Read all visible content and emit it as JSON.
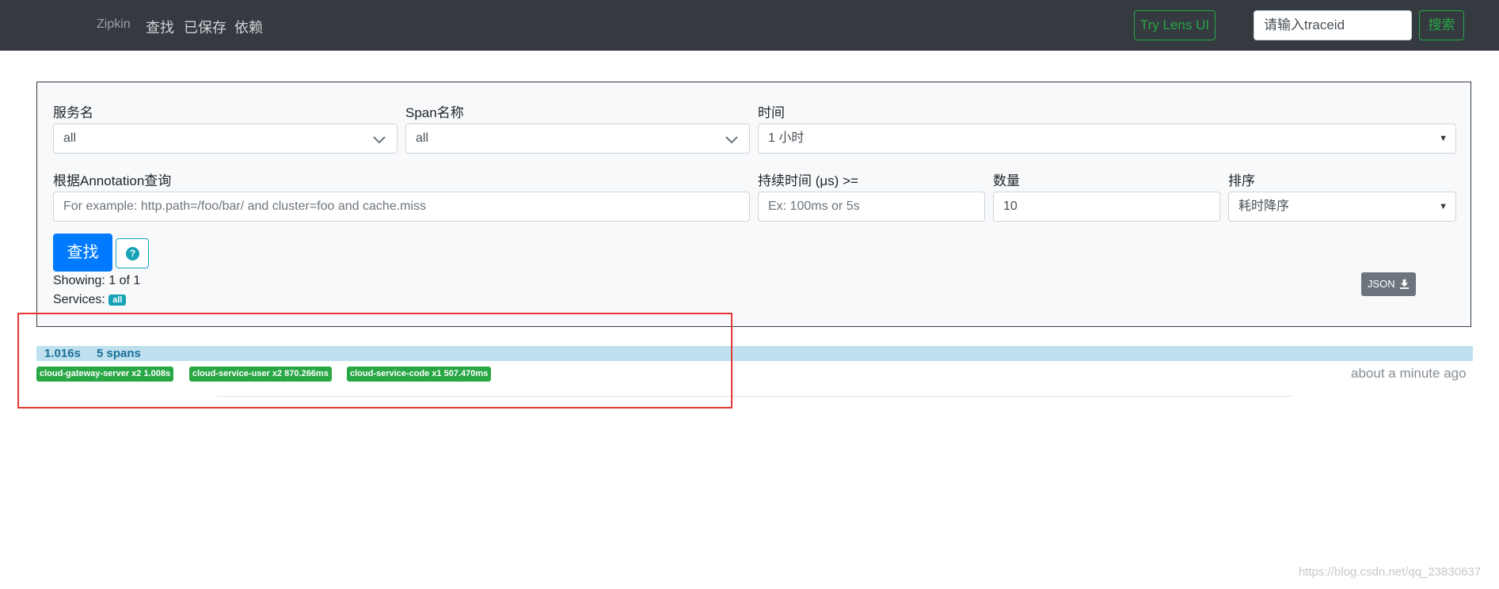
{
  "navbar": {
    "brand": "Zipkin",
    "links": [
      "查找",
      "已保存",
      "依赖"
    ],
    "lens_button": "Try Lens UI",
    "traceid_placeholder": "请输入traceid",
    "search_button": "搜索"
  },
  "form": {
    "service_label": "服务名",
    "service_value": "all",
    "span_label": "Span名称",
    "span_value": "all",
    "time_label": "时间",
    "time_value": "1 小时",
    "annotation_label": "根据Annotation查询",
    "annotation_placeholder": "For example: http.path=/foo/bar/ and cluster=foo and cache.miss",
    "duration_label": "持续时间 (μs) >=",
    "duration_placeholder": "Ex: 100ms or 5s",
    "limit_label": "数量",
    "limit_value": "10",
    "sort_label": "排序",
    "sort_value": "耗时降序",
    "find_button": "查找",
    "help_icon_glyph": "?",
    "showing": "Showing: 1 of 1",
    "services_label": "Services:",
    "services_badge": "all",
    "json_button": "JSON"
  },
  "trace": {
    "duration": "1.016s",
    "spans": "5 spans",
    "services": [
      "cloud-gateway-server x2 1.008s",
      "cloud-service-user x2 870.266ms",
      "cloud-service-code x1 507.470ms"
    ],
    "timestamp": "about a minute ago"
  },
  "watermark": "https://blog.csdn.net/qq_23830637",
  "colors": {
    "navbar": "#343a40",
    "success": "#28a745",
    "primary": "#007bff",
    "info": "#17a2b8",
    "highlight": "#e53935"
  }
}
